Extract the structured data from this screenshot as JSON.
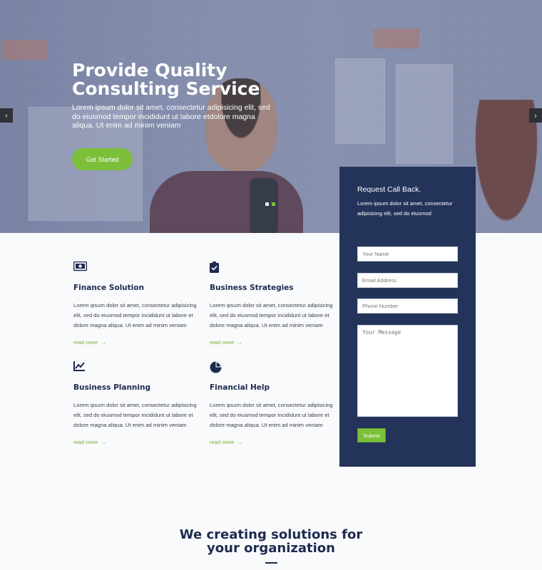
{
  "hero": {
    "title": "Provide Quality Consulting Service",
    "text": "Lorem ipsum dolor sit amet, consectetur adipisicing elit, sed do eiusmod tempor incididunt ut labore etdolore magna aliqua. Ut enim ad minim veniam",
    "cta_label": "Get Started",
    "prev_arrow": "‹",
    "next_arrow": "›"
  },
  "services": [
    {
      "icon": "money-icon",
      "title": "Finance Solution",
      "text": "Lorem ipsum dolor sit amet, consectetur adipisicing elit, sed do eiusmod tempor incididunt ut labore et dolore magna aliqua. Ut enim ad minim veniam",
      "link": "read more"
    },
    {
      "icon": "clipboard-check-icon",
      "title": "Business Strategies",
      "text": "Lorem ipsum dolor sit amet, consectetur adipisicing elit, sed do eiusmod tempor incididunt ut labore et dolore magna aliqua. Ut enim ad minim veniam",
      "link": "read more"
    },
    {
      "icon": "line-chart-icon",
      "title": "Business Planning",
      "text": "Lorem ipsum dolor sit amet, consectetur adipisicing elit, sed do eiusmod tempor incididunt ut labore et dolore magna aliqua. Ut enim ad minim veniam",
      "link": "read more"
    },
    {
      "icon": "pie-chart-icon",
      "title": "Financial Help",
      "text": "Lorem ipsum dolor sit amet, consectetur adipisicing elit, sed do eiusmod tempor incididunt ut labore et dolore magna aliqua. Ut enim ad minim veniam",
      "link": "read more"
    }
  ],
  "callback_form": {
    "title": "Request Call Back.",
    "subtitle": "Lorem ipsum dolor sit amet, consectetur adipisicing elit, sed do eiusmod",
    "name_placeholder": "Your Name",
    "email_placeholder": "Email Address",
    "phone_placeholder": "Phone Number",
    "message_placeholder": "Your Message",
    "submit_label": "Submit"
  },
  "solutions": {
    "title_line1": "We creating solutions for",
    "title_line2": "your organization"
  },
  "colors": {
    "accent": "#7bbf3a",
    "navy": "#24335a",
    "heading": "#1e2b4f"
  }
}
